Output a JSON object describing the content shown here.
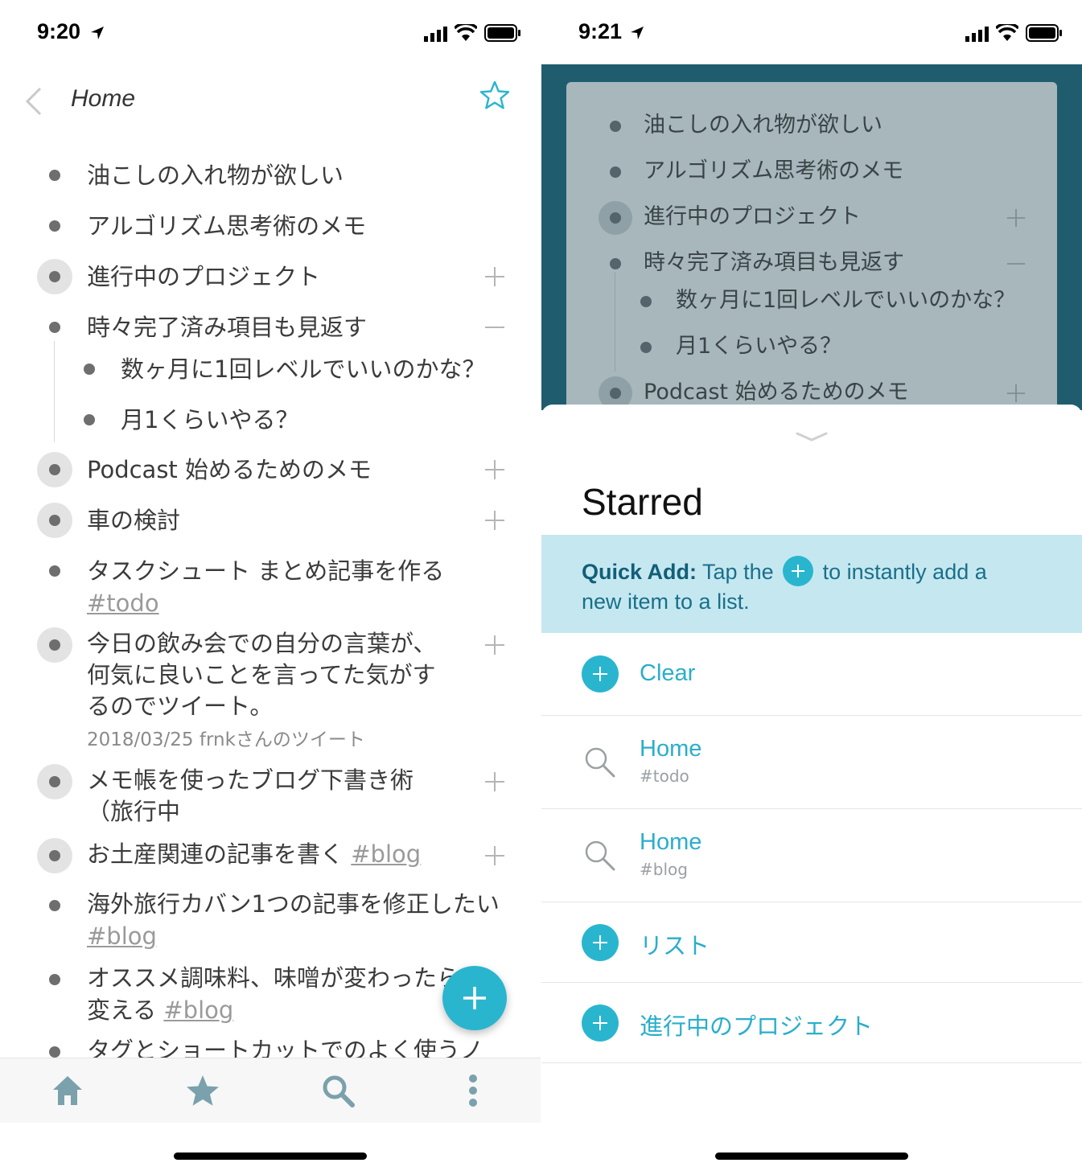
{
  "left": {
    "status": {
      "time": "9:20"
    },
    "nav": {
      "title": "Home"
    },
    "items": [
      {
        "text": "油こしの入れ物が欲しい"
      },
      {
        "text": "アルゴリズム思考術のメモ"
      },
      {
        "text": "進行中のプロジェクト"
      },
      {
        "text": "時々完了済み項目も見返す"
      },
      {
        "text": "数ヶ月に1回レベルでいいのかな？"
      },
      {
        "text": "月1くらいやる？"
      },
      {
        "text": "Podcast 始めるためのメモ"
      },
      {
        "text": "車の検討"
      },
      {
        "text": "タスクシュート まとめ記事を作る",
        "tag": "#todo"
      },
      {
        "lines": [
          "今日の飲み会での自分の言葉が、",
          "何気に良いことを言ってた気がす",
          "るのでツイート。"
        ],
        "note": "2018/03/25 frnkさんのツイート"
      },
      {
        "lines": [
          "メモ帳を使ったブログ下書き術",
          "（旅行中"
        ]
      },
      {
        "text": "お土産関連の記事を書く",
        "tag": "#blog"
      },
      {
        "text": "海外旅行カバン1つの記事を修正したい",
        "tag": "#blog"
      },
      {
        "text": "オススメ調味料、味噌が変わったら",
        "line2": "変える",
        "tag": "#blog"
      },
      {
        "text": "タグとショートカットでのよく使うノ"
      }
    ]
  },
  "right": {
    "status": {
      "time": "9:21"
    },
    "preview": [
      {
        "text": "油こしの入れ物が欲しい"
      },
      {
        "text": "アルゴリズム思考術のメモ"
      },
      {
        "text": "進行中のプロジェクト"
      },
      {
        "text": "時々完了済み項目も見返す"
      },
      {
        "text": "数ヶ月に1回レベルでいいのかな？"
      },
      {
        "text": "月1くらいやる？"
      },
      {
        "text": "Podcast 始めるためのメモ"
      }
    ],
    "sheet": {
      "title": "Starred",
      "tip": {
        "bold": "Quick Add:",
        "part1": " Tap the ",
        "part2": " to instantly add a",
        "line2": "new item to a list."
      },
      "rows": [
        {
          "label": "Clear"
        },
        {
          "label": "Home",
          "sub": "#todo"
        },
        {
          "label": "Home",
          "sub": "#blog"
        },
        {
          "label": "リスト"
        },
        {
          "label": "進行中のプロジェクト"
        }
      ]
    }
  }
}
